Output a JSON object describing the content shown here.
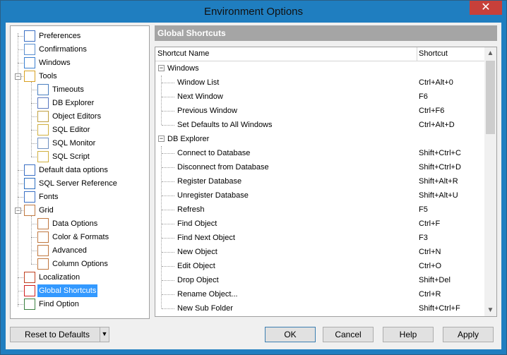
{
  "window": {
    "title": "Environment Options",
    "close_glyph": "✕"
  },
  "tree": {
    "items": [
      {
        "label": "Preferences",
        "icon": "preferences-icon"
      },
      {
        "label": "Confirmations",
        "icon": "confirmations-icon"
      },
      {
        "label": "Windows",
        "icon": "windows-icon"
      },
      {
        "label": "Tools",
        "icon": "tools-icon"
      },
      {
        "label": "Timeouts",
        "icon": "timeouts-icon"
      },
      {
        "label": "DB Explorer",
        "icon": "db-explorer-icon"
      },
      {
        "label": "Object Editors",
        "icon": "object-editors-icon"
      },
      {
        "label": "SQL Editor",
        "icon": "sql-editor-icon"
      },
      {
        "label": "SQL Monitor",
        "icon": "sql-monitor-icon"
      },
      {
        "label": "SQL Script",
        "icon": "sql-script-icon"
      },
      {
        "label": "Default data options",
        "icon": "default-data-options-icon"
      },
      {
        "label": "SQL Server Reference",
        "icon": "help-icon"
      },
      {
        "label": "Fonts",
        "icon": "fonts-icon"
      },
      {
        "label": "Grid",
        "icon": "grid-icon"
      },
      {
        "label": "Data Options",
        "icon": "grid-icon"
      },
      {
        "label": "Color & Formats",
        "icon": "grid-icon"
      },
      {
        "label": "Advanced",
        "icon": "grid-icon"
      },
      {
        "label": "Column Options",
        "icon": "grid-icon"
      },
      {
        "label": "Localization",
        "icon": "localization-icon"
      },
      {
        "label": "Global Shortcuts",
        "icon": "shortcuts-icon"
      },
      {
        "label": "Find Option",
        "icon": "find-option-icon"
      }
    ]
  },
  "panel": {
    "title": "Global Shortcuts"
  },
  "grid": {
    "columns": [
      "Shortcut Name",
      "Shortcut"
    ],
    "groups": [
      {
        "name": "Windows",
        "rows": [
          [
            "Window List",
            "Ctrl+Alt+0"
          ],
          [
            "Next Window",
            "F6"
          ],
          [
            "Previous Window",
            "Ctrl+F6"
          ],
          [
            "Set Defaults to All Windows",
            "Ctrl+Alt+D"
          ]
        ]
      },
      {
        "name": "DB Explorer",
        "rows": [
          [
            "Connect to Database",
            "Shift+Ctrl+C"
          ],
          [
            "Disconnect from Database",
            "Shift+Ctrl+D"
          ],
          [
            "Register Database",
            "Shift+Alt+R"
          ],
          [
            "Unregister Database",
            "Shift+Alt+U"
          ],
          [
            "Refresh",
            "F5"
          ],
          [
            "Find Object",
            "Ctrl+F"
          ],
          [
            "Find Next Object",
            "F3"
          ],
          [
            "New Object",
            "Ctrl+N"
          ],
          [
            "Edit Object",
            "Ctrl+O"
          ],
          [
            "Drop Object",
            "Shift+Del"
          ],
          [
            "Rename Object...",
            "Ctrl+R"
          ],
          [
            "New Sub Folder",
            "Shift+Ctrl+F"
          ]
        ]
      }
    ]
  },
  "footer": {
    "reset": "Reset to Defaults",
    "ok": "OK",
    "cancel": "Cancel",
    "help": "Help",
    "apply": "Apply"
  },
  "colors": {
    "titlebar": "#1f7ec0",
    "selection": "#3399ff",
    "panel_header": "#a5a5a5",
    "close": "#c7403a"
  }
}
